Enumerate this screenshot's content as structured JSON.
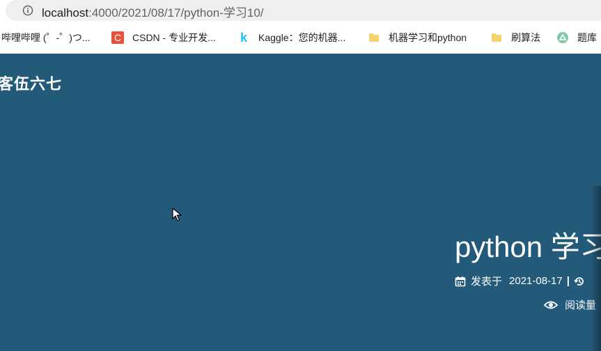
{
  "browser": {
    "url_host": "localhost",
    "url_path": ":4000/2021/08/17/python-学习10/"
  },
  "bookmarks": [
    {
      "label": "哔哩哔哩 (゜-゜)つ...",
      "icon": "bilibili-icon"
    },
    {
      "label": "CSDN - 专业开发...",
      "icon": "csdn-icon"
    },
    {
      "label": "Kaggle：您的机器...",
      "icon": "kaggle-icon"
    },
    {
      "label": "机器学习和python",
      "icon": "folder-icon"
    },
    {
      "label": "刷算法",
      "icon": "folder-icon"
    },
    {
      "label": "题库",
      "icon": "leetcode-icon"
    }
  ],
  "site": {
    "name": "客伍六七"
  },
  "post": {
    "title": "python 学习",
    "published_label": "发表于",
    "date": "2021-08-17",
    "separator": "|",
    "views_label": "阅读量"
  },
  "colors": {
    "hero_bg": "#235a7a",
    "csdn": "#e8513b",
    "kaggle": "#20beff",
    "folder": "#f5d36a"
  }
}
